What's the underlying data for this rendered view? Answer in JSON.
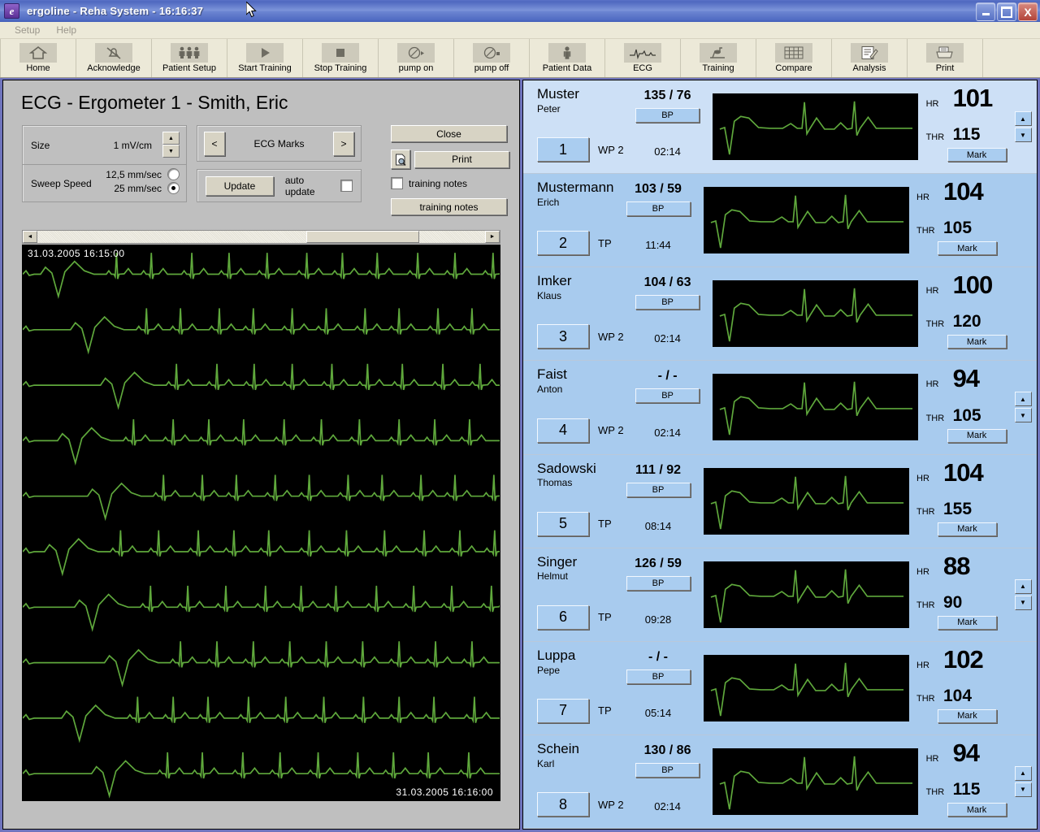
{
  "window": {
    "app_initial": "e",
    "title": "ergoline  - Reha System -  16:16:37",
    "minimize_label": "Minimize",
    "maximize_label": "Maximize",
    "close_label": "X"
  },
  "menu": {
    "items": [
      "Setup",
      "Help"
    ]
  },
  "toolbar": {
    "buttons": [
      {
        "label": "Home",
        "icon": "home-icon"
      },
      {
        "label": "Acknowledge",
        "icon": "bell-muted-icon"
      },
      {
        "label": "Patient Setup",
        "icon": "people-icon"
      },
      {
        "label": "Start Training",
        "icon": "play-icon"
      },
      {
        "label": "Stop Training",
        "icon": "stop-icon"
      },
      {
        "label": "pump on",
        "icon": "pump-on-icon"
      },
      {
        "label": "pump off",
        "icon": "pump-off-icon"
      },
      {
        "label": "Patient Data",
        "icon": "person-icon"
      },
      {
        "label": "ECG",
        "icon": "ecg-wave-icon"
      },
      {
        "label": "Training",
        "icon": "ergometer-icon"
      },
      {
        "label": "Compare",
        "icon": "grid-icon"
      },
      {
        "label": "Analysis",
        "icon": "report-pen-icon"
      },
      {
        "label": "Print",
        "icon": "printer-icon"
      }
    ]
  },
  "left_panel": {
    "page_title": "ECG - Ergometer 1 -  Smith, Eric",
    "size": {
      "label": "Size",
      "value": "1 mV/cm"
    },
    "sweep_speed": {
      "label": "Sweep Speed",
      "options": [
        {
          "label": "12,5 mm/sec",
          "selected": false
        },
        {
          "label": "25 mm/sec",
          "selected": true
        }
      ]
    },
    "ecg_marks": {
      "label": "ECG Marks",
      "prev": "<",
      "next": ">"
    },
    "update": {
      "button": "Update",
      "auto_label": "auto update",
      "auto_checked": false
    },
    "actions": {
      "close": "Close",
      "print": "Print",
      "print_preview_icon": "print-preview-icon",
      "training_notes_checkbox": "training notes",
      "training_notes_checked": false,
      "training_notes_button": "training notes"
    },
    "ecg_view": {
      "stamp_start": "31.03.2005    16:15:00",
      "stamp_end": "31.03.2005     16:16:00",
      "trace_color": "#5fa83c",
      "background": "#000000",
      "rows": 10
    }
  },
  "patients": [
    {
      "last": "Muster",
      "first": "Peter",
      "number": "1",
      "program": "WP 2",
      "bp": "135 / 76",
      "bp_button": "BP",
      "time": "02:14",
      "hr_label": "HR",
      "hr": "101",
      "thr_label": "THR",
      "thr": "115",
      "mark": "Mark",
      "spinner": true,
      "shade": "norm"
    },
    {
      "last": "Mustermann",
      "first": "Erich",
      "number": "2",
      "program": "TP",
      "bp": "103 / 59",
      "bp_button": "BP",
      "time": "11:44",
      "hr_label": "HR",
      "hr": "104",
      "thr_label": "THR",
      "thr": "105",
      "mark": "Mark",
      "spinner": false,
      "shade": "alt"
    },
    {
      "last": "Imker",
      "first": "Klaus",
      "number": "3",
      "program": "WP 2",
      "bp": "104 / 63",
      "bp_button": "BP",
      "time": "02:14",
      "hr_label": "HR",
      "hr": "100",
      "thr_label": "THR",
      "thr": "120",
      "mark": "Mark",
      "spinner": false,
      "shade": "alt"
    },
    {
      "last": "Faist",
      "first": "Anton",
      "number": "4",
      "program": "WP 2",
      "bp": "- / -",
      "bp_button": "BP",
      "time": "02:14",
      "hr_label": "HR",
      "hr": "94",
      "thr_label": "THR",
      "thr": "105",
      "mark": "Mark",
      "spinner": true,
      "shade": "alt"
    },
    {
      "last": "Sadowski",
      "first": "Thomas",
      "number": "5",
      "program": "TP",
      "bp": "111 / 92",
      "bp_button": "BP",
      "time": "08:14",
      "hr_label": "HR",
      "hr": "104",
      "thr_label": "THR",
      "thr": "155",
      "mark": "Mark",
      "spinner": false,
      "shade": "alt"
    },
    {
      "last": "Singer",
      "first": "Helmut",
      "number": "6",
      "program": "TP",
      "bp": "126 / 59",
      "bp_button": "BP",
      "time": "09:28",
      "hr_label": "HR",
      "hr": "88",
      "thr_label": "THR",
      "thr": "90",
      "mark": "Mark",
      "spinner": true,
      "shade": "alt"
    },
    {
      "last": "Luppa",
      "first": "Pepe",
      "number": "7",
      "program": "TP",
      "bp": "- / -",
      "bp_button": "BP",
      "time": "05:14",
      "hr_label": "HR",
      "hr": "102",
      "thr_label": "THR",
      "thr": "104",
      "mark": "Mark",
      "spinner": false,
      "shade": "alt"
    },
    {
      "last": "Schein",
      "first": "Karl",
      "number": "8",
      "program": "WP 2",
      "bp": "130 / 86",
      "bp_button": "BP",
      "time": "02:14",
      "hr_label": "HR",
      "hr": "94",
      "thr_label": "THR",
      "thr": "115",
      "mark": "Mark",
      "spinner": true,
      "shade": "alt"
    }
  ],
  "scrollbar": {
    "left_arrow": "◄",
    "right_arrow": "►",
    "thumb_position_pct": 60
  }
}
